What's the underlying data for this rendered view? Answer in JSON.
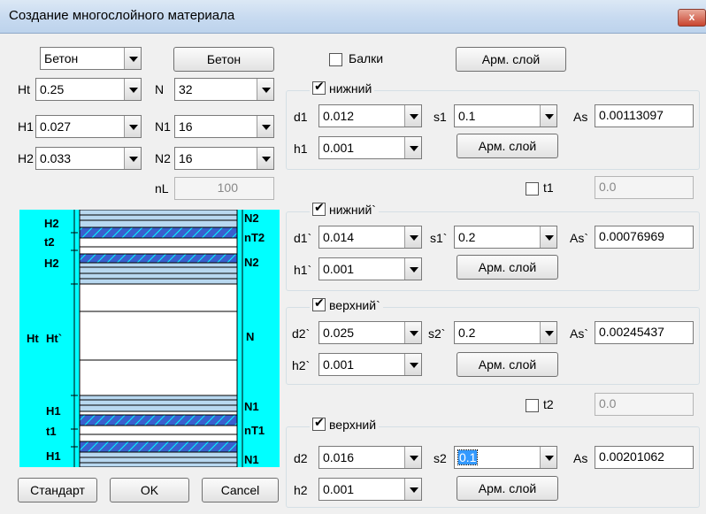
{
  "window": {
    "title": "Создание многослойного материала",
    "close_glyph": "x"
  },
  "left": {
    "material": "Бетон",
    "material_button": "Бетон",
    "Ht": {
      "label": "Ht",
      "value": "0.25"
    },
    "H1": {
      "label": "H1",
      "value": "0.027"
    },
    "H2": {
      "label": "H2",
      "value": "0.033"
    },
    "N": {
      "label": "N",
      "value": "32"
    },
    "N1": {
      "label": "N1",
      "value": "16"
    },
    "N2": {
      "label": "N2",
      "value": "16"
    },
    "nL": {
      "label": "nL",
      "value": "100"
    }
  },
  "diagram": {
    "left_labels": [
      "H2",
      "t2",
      "H2",
      "Ht",
      "Ht`",
      "H1",
      "t1",
      "H1"
    ],
    "right_labels": [
      "N2",
      "nT2",
      "N2",
      "N",
      "N1",
      "nT1",
      "N1"
    ],
    "colors": {
      "background": "#00ffff",
      "hatch": "#3a5fcd",
      "band": "#b8d8f0"
    }
  },
  "buttons": {
    "standard": "Стандарт",
    "ok": "OK",
    "cancel": "Cancel"
  },
  "top": {
    "beams_label": "Балки",
    "beams_checked": false,
    "arm_button": "Арм. слой"
  },
  "groups": [
    {
      "title": "нижний",
      "checked": true,
      "d": {
        "label": "d1",
        "value": "0.012"
      },
      "s": {
        "label": "s1",
        "value": "0.1",
        "selected": false
      },
      "as": {
        "label": "As",
        "value": "0.00113097"
      },
      "h": {
        "label": "h1",
        "value": "0.001"
      },
      "arm_button": "Арм. слой"
    },
    {
      "title": "нижний`",
      "checked": true,
      "d": {
        "label": "d1`",
        "value": "0.014"
      },
      "s": {
        "label": "s1`",
        "value": "0.2",
        "selected": false
      },
      "as": {
        "label": "As`",
        "value": "0.00076969"
      },
      "h": {
        "label": "h1`",
        "value": "0.001"
      },
      "arm_button": "Арм. слой"
    },
    {
      "title": "верхний`",
      "checked": true,
      "d": {
        "label": "d2`",
        "value": "0.025"
      },
      "s": {
        "label": "s2`",
        "value": "0.2",
        "selected": false
      },
      "as": {
        "label": "As`",
        "value": "0.00245437"
      },
      "h": {
        "label": "h2`",
        "value": "0.001"
      },
      "arm_button": "Арм. слой"
    },
    {
      "title": "верхний",
      "checked": true,
      "d": {
        "label": "d2",
        "value": "0.016"
      },
      "s": {
        "label": "s2",
        "value": "0.1",
        "selected": true
      },
      "as": {
        "label": "As",
        "value": "0.00201062"
      },
      "h": {
        "label": "h2",
        "value": "0.001"
      },
      "arm_button": "Арм. слой"
    }
  ],
  "t1": {
    "label": "t1",
    "checked": false,
    "value": "0.0"
  },
  "t2": {
    "label": "t2",
    "checked": false,
    "value": "0.0"
  }
}
